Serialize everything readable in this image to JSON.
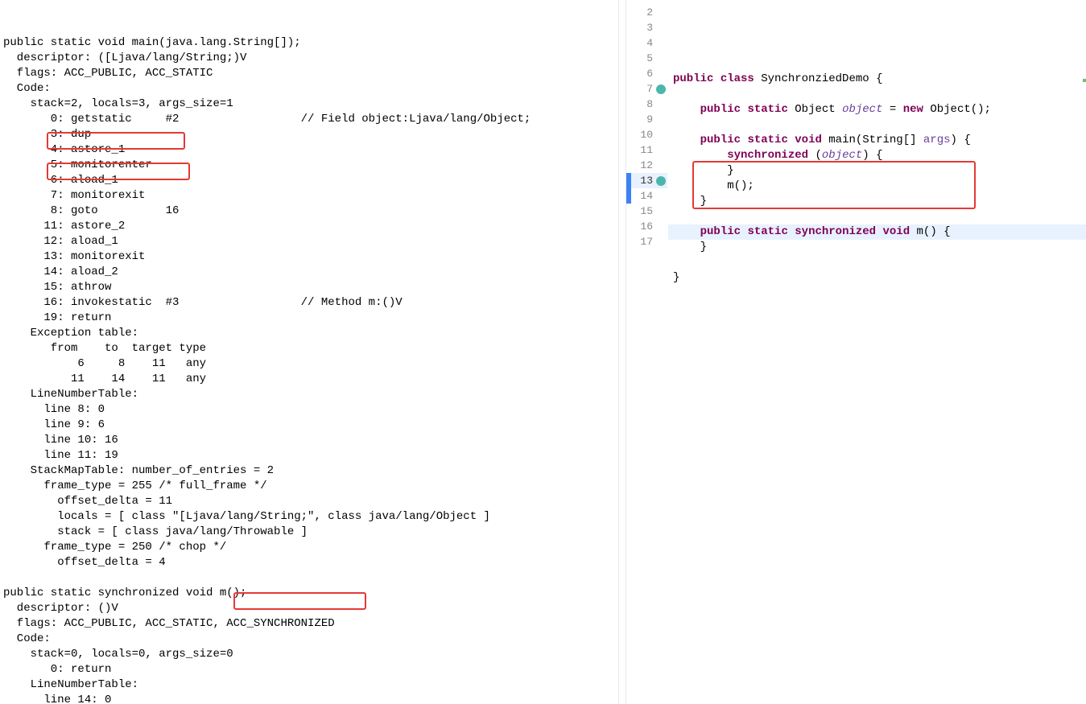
{
  "bytecode": {
    "lines": [
      "public static void main(java.lang.String[]);",
      "  descriptor: ([Ljava/lang/String;)V",
      "  flags: ACC_PUBLIC, ACC_STATIC",
      "  Code:",
      "    stack=2, locals=3, args_size=1",
      "       0: getstatic     #2                  // Field object:Ljava/lang/Object;",
      "       3: dup",
      "       4: astore_1",
      "       5: monitorenter",
      "       6: aload_1",
      "       7: monitorexit",
      "       8: goto          16",
      "      11: astore_2",
      "      12: aload_1",
      "      13: monitorexit",
      "      14: aload_2",
      "      15: athrow",
      "      16: invokestatic  #3                  // Method m:()V",
      "      19: return",
      "    Exception table:",
      "       from    to  target type",
      "           6     8    11   any",
      "          11    14    11   any",
      "    LineNumberTable:",
      "      line 8: 0",
      "      line 9: 6",
      "      line 10: 16",
      "      line 11: 19",
      "    StackMapTable: number_of_entries = 2",
      "      frame_type = 255 /* full_frame */",
      "        offset_delta = 11",
      "        locals = [ class \"[Ljava/lang/String;\", class java/lang/Object ]",
      "        stack = [ class java/lang/Throwable ]",
      "      frame_type = 250 /* chop */",
      "        offset_delta = 4",
      "",
      "public static synchronized void m();",
      "  descriptor: ()V",
      "  flags: ACC_PUBLIC, ACC_STATIC, ACC_SYNCHRONIZED",
      "  Code:",
      "    stack=0, locals=0, args_size=0",
      "       0: return",
      "    LineNumberTable:",
      "      line 14: 0"
    ]
  },
  "source": {
    "startLine": 2,
    "currentLine": 13,
    "selectedLines": [
      13,
      14
    ],
    "tokens": [
      [
        {
          "t": "",
          "c": ""
        }
      ],
      [
        {
          "t": "public",
          "c": "kw"
        },
        {
          "t": " ",
          "c": ""
        },
        {
          "t": "class",
          "c": "kw"
        },
        {
          "t": " SynchronziedDemo {",
          "c": ""
        }
      ],
      [
        {
          "t": "",
          "c": ""
        }
      ],
      [
        {
          "t": "    ",
          "c": ""
        },
        {
          "t": "public",
          "c": "kw"
        },
        {
          "t": " ",
          "c": ""
        },
        {
          "t": "static",
          "c": "kw"
        },
        {
          "t": " Object ",
          "c": ""
        },
        {
          "t": "object",
          "c": "var"
        },
        {
          "t": " = ",
          "c": ""
        },
        {
          "t": "new",
          "c": "kw"
        },
        {
          "t": " Object();",
          "c": ""
        }
      ],
      [
        {
          "t": "",
          "c": ""
        }
      ],
      [
        {
          "t": "    ",
          "c": ""
        },
        {
          "t": "public",
          "c": "kw"
        },
        {
          "t": " ",
          "c": ""
        },
        {
          "t": "static",
          "c": "kw"
        },
        {
          "t": " ",
          "c": ""
        },
        {
          "t": "void",
          "c": "kw"
        },
        {
          "t": " main(String[] ",
          "c": ""
        },
        {
          "t": "args",
          "c": "param"
        },
        {
          "t": ") {",
          "c": ""
        }
      ],
      [
        {
          "t": "        ",
          "c": ""
        },
        {
          "t": "synchronized",
          "c": "kw"
        },
        {
          "t": " (",
          "c": ""
        },
        {
          "t": "object",
          "c": "var"
        },
        {
          "t": ") {",
          "c": ""
        }
      ],
      [
        {
          "t": "        }",
          "c": ""
        }
      ],
      [
        {
          "t": "        m();",
          "c": ""
        }
      ],
      [
        {
          "t": "    }",
          "c": ""
        }
      ],
      [
        {
          "t": "",
          "c": ""
        }
      ],
      [
        {
          "t": "    ",
          "c": ""
        },
        {
          "t": "public",
          "c": "kw"
        },
        {
          "t": " ",
          "c": ""
        },
        {
          "t": "static",
          "c": "kw"
        },
        {
          "t": " ",
          "c": ""
        },
        {
          "t": "synchronized",
          "c": "kw"
        },
        {
          "t": " ",
          "c": ""
        },
        {
          "t": "void",
          "c": "kw"
        },
        {
          "t": " m() {",
          "c": ""
        }
      ],
      [
        {
          "t": "    }",
          "c": ""
        }
      ],
      [
        {
          "t": "",
          "c": ""
        }
      ],
      [
        {
          "t": "}",
          "c": ""
        }
      ],
      [
        {
          "t": "",
          "c": ""
        }
      ]
    ],
    "markers": {
      "7": "teal",
      "13": "teal"
    }
  }
}
